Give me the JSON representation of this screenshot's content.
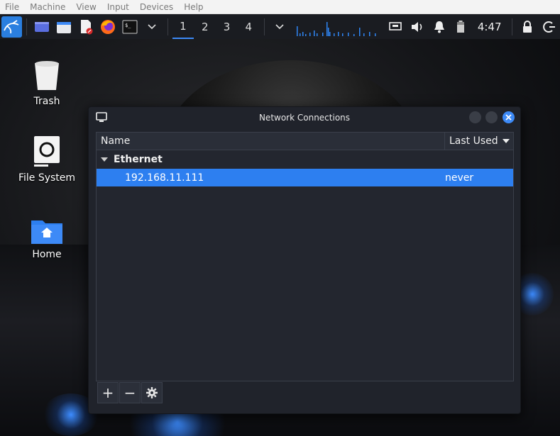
{
  "host_menu": [
    "File",
    "Machine",
    "View",
    "Input",
    "Devices",
    "Help"
  ],
  "panel": {
    "workspaces": [
      "1",
      "2",
      "3",
      "4"
    ],
    "active_workspace": "1",
    "clock": "4:47",
    "icons": [
      "kali-menu-icon",
      "show-desktop-icon",
      "file-manager-icon",
      "text-editor-icon",
      "firefox-icon",
      "terminal-icon",
      "chevron-down-icon",
      "network-icon",
      "volume-icon",
      "notification-icon",
      "battery-icon",
      "lock-icon",
      "logout-icon"
    ]
  },
  "desktop": {
    "icons": [
      {
        "label": "Trash",
        "icon": "trash-icon"
      },
      {
        "label": "File System",
        "icon": "drive-icon"
      },
      {
        "label": "Home",
        "icon": "home-folder-icon"
      }
    ]
  },
  "window": {
    "title": "Network Connections",
    "columns": {
      "name": "Name",
      "last_used": "Last Used"
    },
    "groups": [
      {
        "label": "Ethernet",
        "connections": [
          {
            "name": "192.168.11.111",
            "last_used": "never",
            "selected": true
          }
        ]
      }
    ],
    "toolbar": {
      "add": "+",
      "remove": "−",
      "settings": "gear-icon"
    }
  },
  "colors": {
    "accent": "#2d7ff0",
    "panel_bg": "#1a1c21",
    "window_bg": "#20232b",
    "close_button": "#3d8af7"
  }
}
